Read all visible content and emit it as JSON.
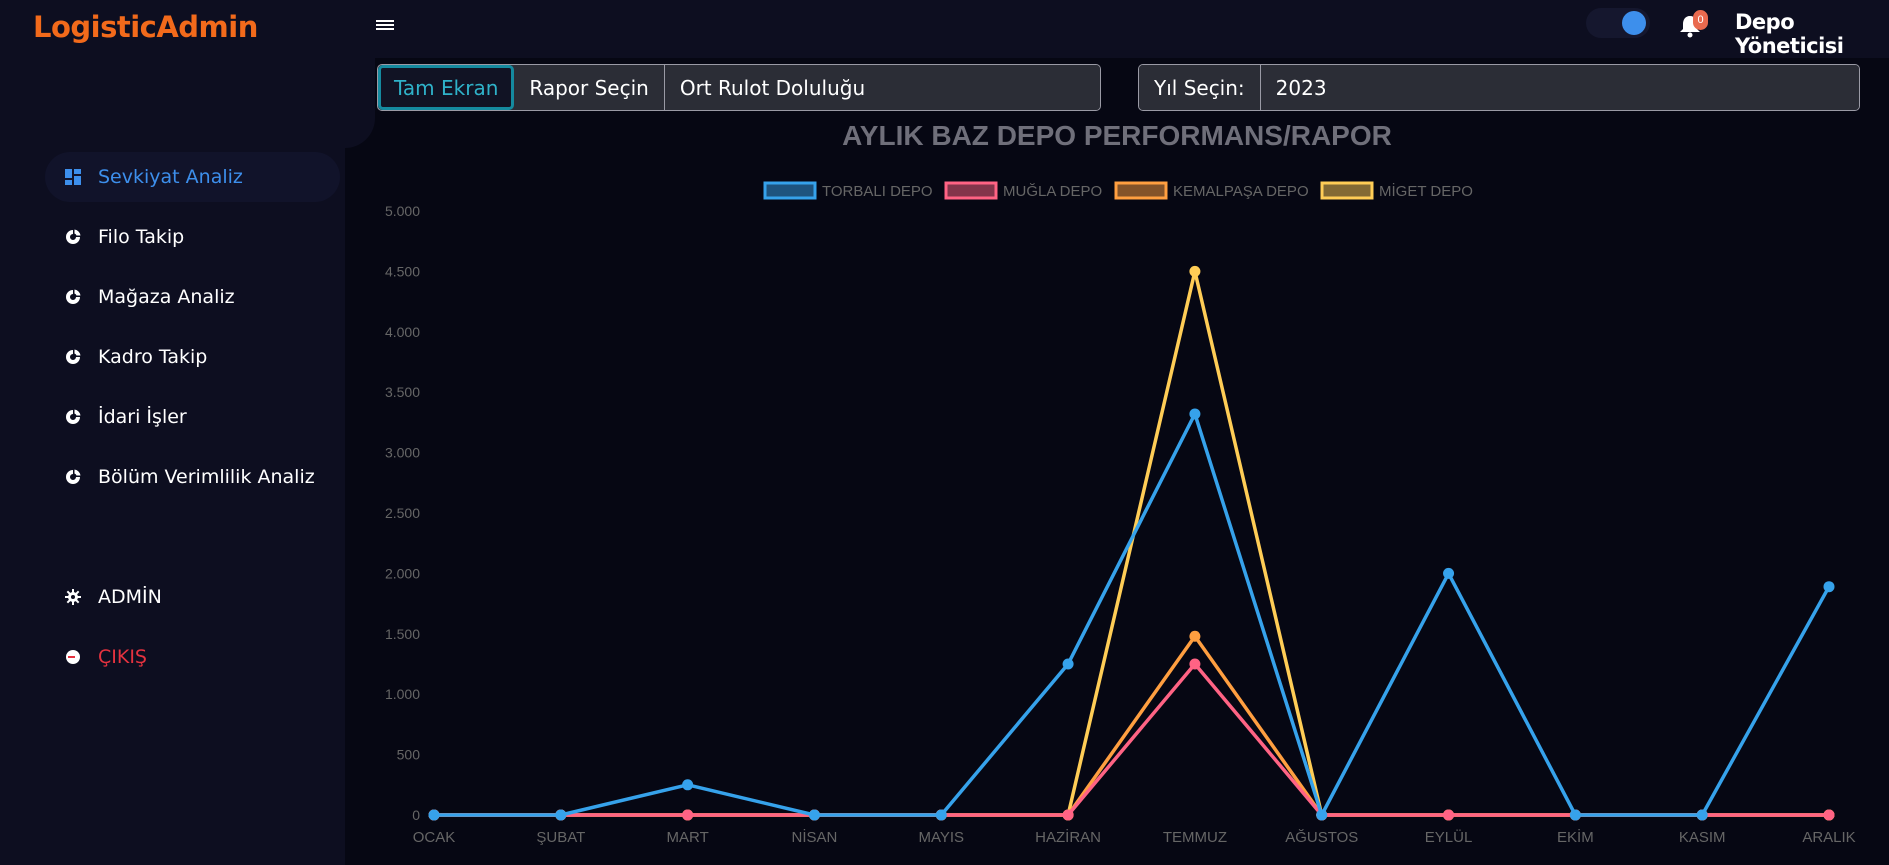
{
  "app": {
    "brand": "LogisticAdmin",
    "user_name": "Depo Yöneticisi",
    "notification_count": "0",
    "theme_toggle_on": true
  },
  "sidebar": {
    "items": [
      {
        "label": "Sevkiyat Analiz",
        "icon": "dashboard-icon",
        "active": true
      },
      {
        "label": "Filo Takip",
        "icon": "donut-chart-icon"
      },
      {
        "label": "Mağaza Analiz",
        "icon": "donut-chart-icon"
      },
      {
        "label": "Kadro Takip",
        "icon": "donut-chart-icon"
      },
      {
        "label": "İdari İşler",
        "icon": "donut-chart-icon"
      },
      {
        "label": "Bölüm Verimlilik Analiz",
        "icon": "donut-chart-icon"
      }
    ],
    "bottom_items": [
      {
        "label": "ADMİN",
        "icon": "gear-icon"
      },
      {
        "label": "ÇIKIŞ",
        "icon": "logout-icon",
        "danger": true
      }
    ]
  },
  "controls": {
    "fullscreen_label": "Tam Ekran",
    "report_label": "Rapor Seçin",
    "report_value": "Ort Rulot Doluluğu",
    "year_label": "Yıl Seçin:",
    "year_value": "2023"
  },
  "colors": {
    "accent": "#3d8fec",
    "brand": "#f26a1b",
    "danger": "#e5323f"
  },
  "chart_data": {
    "type": "line",
    "title": "AYLIK BAZ DEPO PERFORMANS/RAPOR",
    "xlabel": "",
    "ylabel": "",
    "ylim": [
      0,
      5000
    ],
    "yticks": [
      "0",
      "500",
      "1.000",
      "1.500",
      "2.000",
      "2.500",
      "3.000",
      "3.500",
      "4.000",
      "4.500",
      "5.000"
    ],
    "ytick_values": [
      0,
      500,
      1000,
      1500,
      2000,
      2500,
      3000,
      3500,
      4000,
      4500,
      5000
    ],
    "grid": false,
    "legend_position": "top-center",
    "categories": [
      "OCAK",
      "ŞUBAT",
      "MART",
      "NİSAN",
      "MAYIS",
      "HAZİRAN",
      "TEMMUZ",
      "AĞUSTOS",
      "EYLÜL",
      "EKİM",
      "KASIM",
      "ARALIK"
    ],
    "series": [
      {
        "name": "TORBALI DEPO",
        "color": "#36a2eb",
        "values": [
          0,
          0,
          250,
          0,
          0,
          1250,
          3320,
          0,
          2000,
          0,
          0,
          1890
        ]
      },
      {
        "name": "MUĞLA DEPO",
        "color": "#ff6384",
        "values": [
          0,
          0,
          0,
          0,
          0,
          0,
          1250,
          0,
          0,
          0,
          0,
          0
        ]
      },
      {
        "name": "KEMALPAŞA DEPO",
        "color": "#ff9f40",
        "values": [
          0,
          0,
          0,
          0,
          0,
          0,
          1480,
          0,
          0,
          0,
          0,
          0
        ]
      },
      {
        "name": "MİGET DEPO",
        "color": "#ffcd56",
        "values": [
          0,
          0,
          0,
          0,
          0,
          0,
          4500,
          0,
          0,
          0,
          0,
          0
        ]
      }
    ]
  }
}
